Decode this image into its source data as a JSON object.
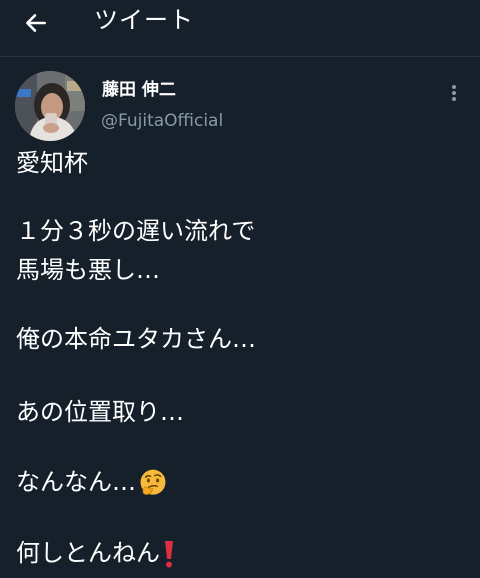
{
  "header": {
    "title": "ツイート",
    "back_icon": "arrow-left-icon"
  },
  "author": {
    "display_name": "藤田 伸二",
    "handle": "@FujitaOfficial"
  },
  "more_icon": "more-vertical-icon",
  "tweet": {
    "lines": [
      "愛知杯",
      "１分３秒の遅い流れで",
      "馬場も悪し…",
      "俺の本命ユタカさん…",
      "あの位置取り…",
      "なんなん…",
      "何しとんねん"
    ],
    "emojis": {
      "thinking": "thinking-face-emoji",
      "exclamation": "red-exclamation-emoji"
    }
  },
  "colors": {
    "background": "#15202b",
    "text": "#ffffff",
    "secondary": "#8899a6",
    "divider": "#26323f",
    "exclamation": "#dd2e44",
    "emoji_face": "#f6b93b"
  }
}
